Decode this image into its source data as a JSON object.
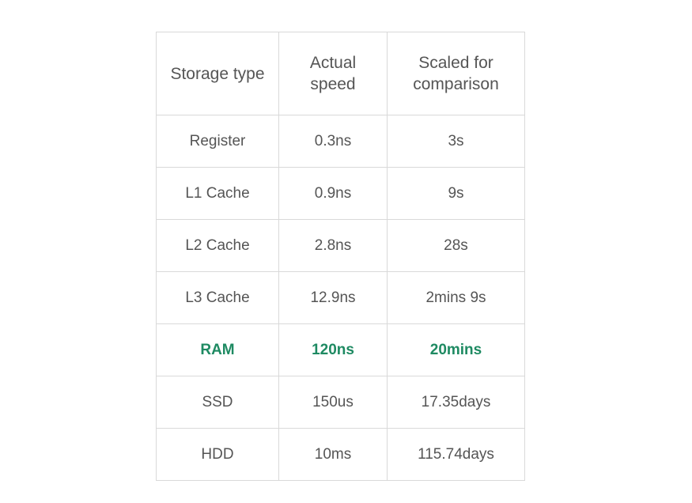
{
  "table": {
    "headers": [
      "Storage type",
      "Actual speed",
      "Scaled for comparison"
    ],
    "highlight_color": "#1e8a62",
    "rows": [
      {
        "type": "Register",
        "actual": "0.3ns",
        "scaled": "3s",
        "highlighted": false
      },
      {
        "type": "L1 Cache",
        "actual": "0.9ns",
        "scaled": "9s",
        "highlighted": false
      },
      {
        "type": "L2 Cache",
        "actual": "2.8ns",
        "scaled": "28s",
        "highlighted": false
      },
      {
        "type": "L3 Cache",
        "actual": "12.9ns",
        "scaled": "2mins 9s",
        "highlighted": false
      },
      {
        "type": "RAM",
        "actual": "120ns",
        "scaled": "20mins",
        "highlighted": true
      },
      {
        "type": "SSD",
        "actual": "150us",
        "scaled": "17.35days",
        "highlighted": false
      },
      {
        "type": "HDD",
        "actual": "10ms",
        "scaled": "115.74days",
        "highlighted": false
      }
    ]
  }
}
